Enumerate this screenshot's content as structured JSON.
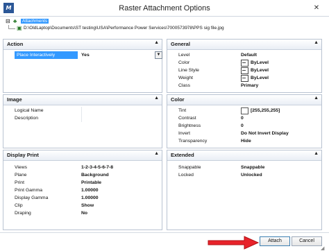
{
  "window": {
    "title": "Raster Attachment Options",
    "close_label": "✕",
    "app_icon": "M"
  },
  "tree": {
    "root_label": "Attachments",
    "child_path": "D:\\OldLaptop\\Documents\\ST testing\\USA\\Performance Power Services\\7000573978\\PPS sig file.jpg"
  },
  "panels": {
    "action": {
      "title": "Action",
      "rows": [
        {
          "label": "Place Interactively",
          "value": "Yes"
        }
      ]
    },
    "general": {
      "title": "General",
      "rows": [
        {
          "label": "Level",
          "value": "Default"
        },
        {
          "label": "Color",
          "value": "ByLevel"
        },
        {
          "label": "Line Style",
          "value": "ByLevel"
        },
        {
          "label": "Weight",
          "value": "ByLevel"
        },
        {
          "label": "Class",
          "value": "Primary"
        }
      ]
    },
    "image": {
      "title": "Image",
      "rows": [
        {
          "label": "Logical Name",
          "value": ""
        },
        {
          "label": "Description",
          "value": ""
        }
      ]
    },
    "color": {
      "title": "Color",
      "rows": [
        {
          "label": "Tint",
          "value": "[255,255,255]"
        },
        {
          "label": "Contrast",
          "value": "0"
        },
        {
          "label": "Brightness",
          "value": "0"
        },
        {
          "label": "Invert",
          "value": "Do Not Invert Display"
        },
        {
          "label": "Transparency",
          "value": "Hide"
        }
      ]
    },
    "display_print": {
      "title": "Display Print",
      "rows": [
        {
          "label": "Views",
          "value": "1-2-3-4-5-6-7-8"
        },
        {
          "label": "Plane",
          "value": "Background"
        },
        {
          "label": "Print",
          "value": "Printable"
        },
        {
          "label": "Print Gamma",
          "value": "1.00000"
        },
        {
          "label": "Display Gamma",
          "value": "1.00000"
        },
        {
          "label": "Clip",
          "value": "Show"
        },
        {
          "label": "Draping",
          "value": "No"
        }
      ]
    },
    "extended": {
      "title": "Extended",
      "rows": [
        {
          "label": "Snappable",
          "value": "Snappable"
        },
        {
          "label": "Locked",
          "value": "Unlocked"
        }
      ]
    }
  },
  "buttons": {
    "attach": "Attach",
    "cancel": "Cancel"
  },
  "colors": {
    "arrow": "#e8232a",
    "selection": "#3399ff",
    "panel_border": "#b9c3d1"
  }
}
